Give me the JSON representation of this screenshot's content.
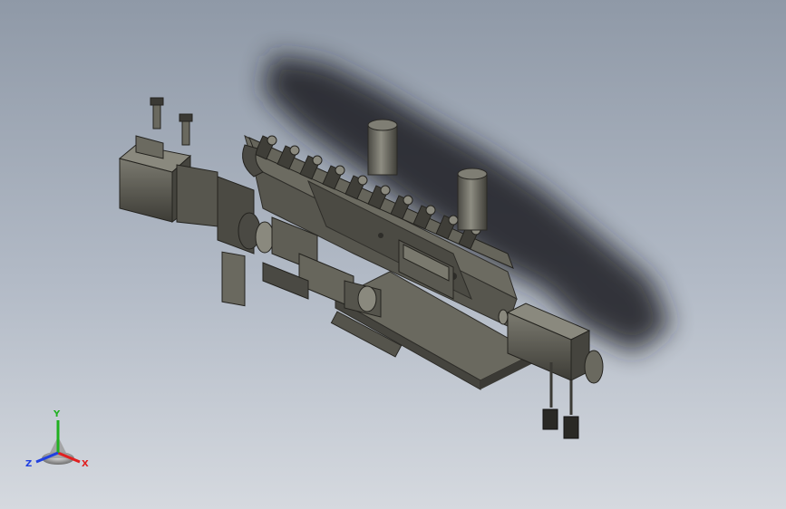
{
  "viewport": {
    "background_top": "#8f99a7",
    "background_bottom": "#d5d9df",
    "model_color": "#5f5e55",
    "model_dark": "#3c3b35",
    "model_light": "#8c8b80",
    "shadow_color": "#1e1f22"
  },
  "triad": {
    "x_label": "X",
    "y_label": "Y",
    "z_label": "Z",
    "x_color": "#e02020",
    "y_color": "#20b020",
    "z_color": "#2040e0"
  }
}
